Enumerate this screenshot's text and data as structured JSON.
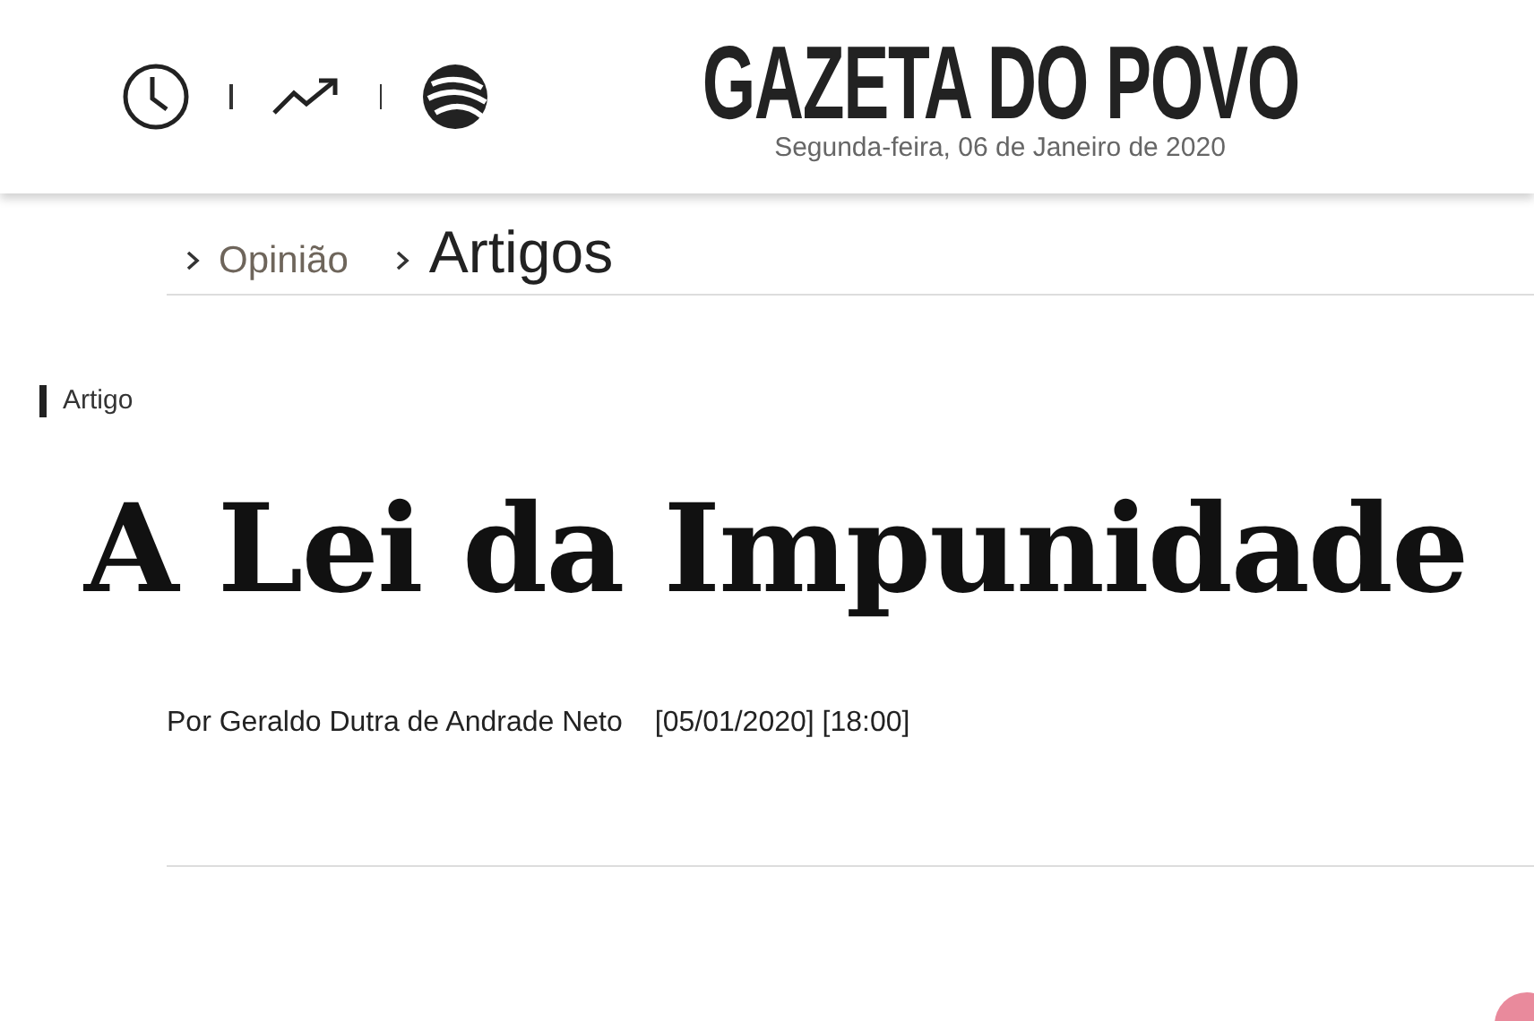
{
  "header": {
    "logo": "GAZETA DO POVO",
    "date": "Segunda-feira, 06 de Janeiro de 2020"
  },
  "breadcrumb": [
    {
      "label": "Opinião",
      "current": false
    },
    {
      "label": "Artigos",
      "current": true
    }
  ],
  "article": {
    "category": "Artigo",
    "title": "A Lei da Impunidade",
    "byline": "Por Geraldo Dutra de Andrade Neto",
    "date": "[05/01/2020] [18:00]"
  }
}
